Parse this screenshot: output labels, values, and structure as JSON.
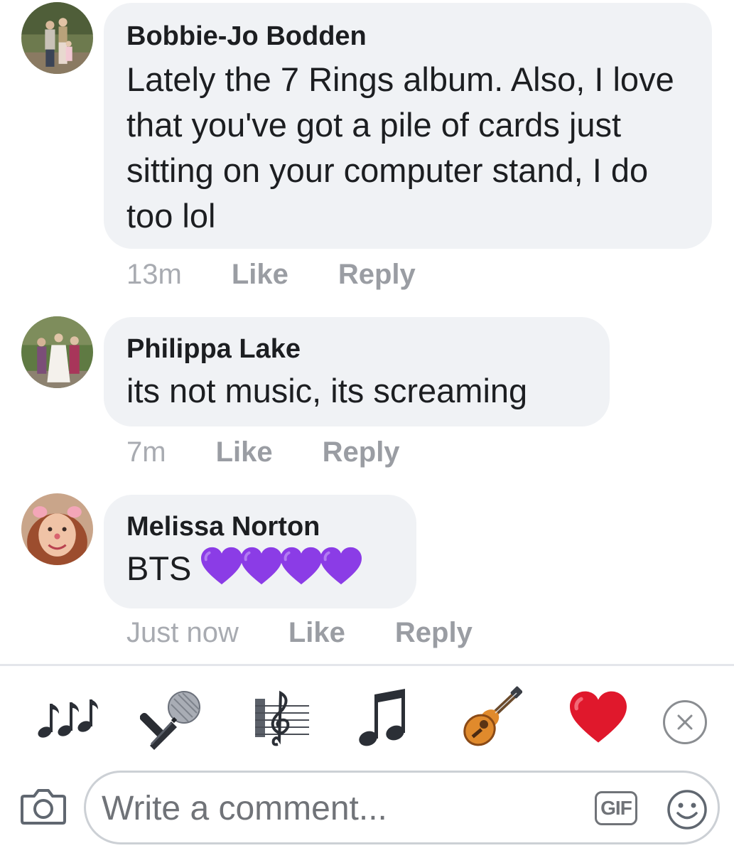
{
  "comments": [
    {
      "author": "Bobbie-Jo Bodden",
      "text": "Lately the 7 Rings album. Also, I love that you've got a pile of cards just sitting on your computer stand, I do too lol",
      "time": "13m",
      "like_label": "Like",
      "reply_label": "Reply"
    },
    {
      "author": "Philippa Lake",
      "text": "its not music, its screaming",
      "time": "7m",
      "like_label": "Like",
      "reply_label": "Reply"
    },
    {
      "author": "Melissa Norton",
      "text": "BTS",
      "emoji": [
        "purple-heart",
        "purple-heart",
        "purple-heart",
        "purple-heart"
      ],
      "time": "Just now",
      "like_label": "Like",
      "reply_label": "Reply"
    }
  ],
  "suggested_emoji": [
    "musical-notes",
    "microphone",
    "musical-score",
    "musical-note",
    "guitar",
    "red-heart"
  ],
  "composer": {
    "placeholder": "Write a comment...",
    "gif_label": "GIF",
    "icons": [
      "camera-icon",
      "gif-icon",
      "smiley-icon",
      "close-icon"
    ]
  },
  "colors": {
    "bubble": "#f0f2f5",
    "meta_text": "#9a9da3",
    "purple_heart": "#8b3ce6",
    "red_heart": "#e0182c"
  }
}
